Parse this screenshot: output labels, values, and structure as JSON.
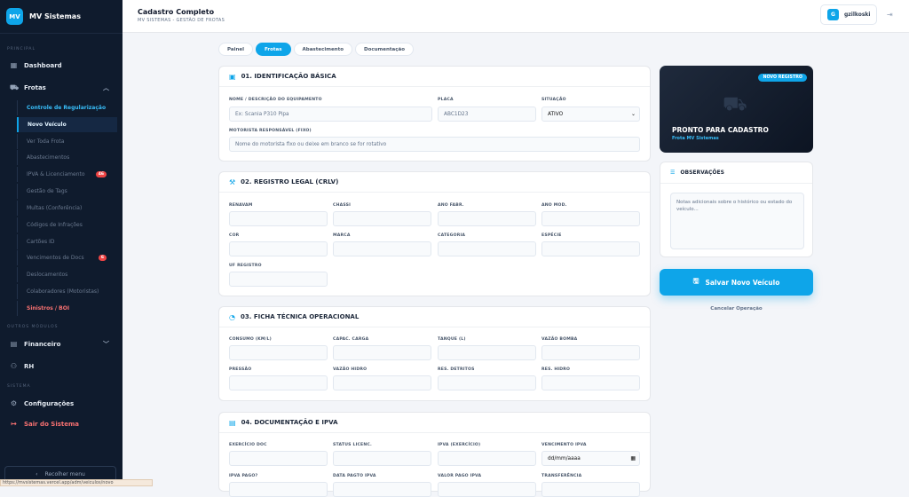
{
  "brand": {
    "logo": "MV",
    "name": "MV Sistemas"
  },
  "sidebar": {
    "sec_principal": "PRINCIPAL",
    "dashboard": "Dashboard",
    "frotas": "Frotas",
    "sub": [
      "Controle de Regularização",
      "Novo Veículo",
      "Ver Toda Frota",
      "Abastecimentos",
      "IPVA & Licenciamento",
      "Gestão de Tags",
      "Multas (Conferência)",
      "Códigos de Infrações",
      "Cartões ID",
      "Vencimentos de Docs",
      "Deslocamentos",
      "Colaboradores (Motoristas)",
      "Sinistros / BOI"
    ],
    "badge_ipva": "46",
    "badge_venc": "6",
    "sec_outros": "OUTROS MÓDULOS",
    "financeiro": "Financeiro",
    "rh": "RH",
    "sec_sistema": "SISTEMA",
    "config": "Configurações",
    "sair": "Sair do Sistema",
    "collapse": "Recolher menu"
  },
  "status_url": "https://mvsistemas.vercel.app/adm/veiculos/novo",
  "header": {
    "title": "Cadastro Completo",
    "subtitle": "MV SISTEMAS - GESTÃO DE FROTAS",
    "user_initial": "G",
    "user_name": "gzilkoski"
  },
  "tabs": [
    "Painel",
    "Frotas",
    "Abastecimento",
    "Documentação"
  ],
  "sec1": {
    "title": "01. IDENTIFICAÇÃO BÁSICA",
    "l_desc": "NOME / DESCRIÇÃO DO EQUIPAMENTO",
    "desc_ph": "Ex: Scania P310 Pipa",
    "l_placa": "PLACA",
    "placa_ph": "ABC1D23",
    "l_sit": "SITUAÇÃO",
    "sit_val": "ATIVO",
    "l_mot": "MOTORISTA RESPONSÁVEL (FIXO)",
    "mot_ph": "Nome do motorista fixo ou deixe em branco se for rotativo"
  },
  "sec2": {
    "title": "02. REGISTRO LEGAL (CRLV)",
    "labels": [
      "RENAVAM",
      "CHASSI",
      "ANO FABR.",
      "ANO MOD.",
      "COR",
      "MARCA",
      "CATEGORIA",
      "ESPÉCIE",
      "UF REGISTRO"
    ]
  },
  "sec3": {
    "title": "03. FICHA TÉCNICA OPERACIONAL",
    "labels": [
      "CONSUMO (KM/L)",
      "CAPAC. CARGA",
      "TANQUE (L)",
      "VAZÃO BOMBA",
      "PRESSÃO",
      "VAZÃO HIDRO",
      "RES. DETRITOS",
      "RES. HIDRO"
    ]
  },
  "sec4": {
    "title": "04. DOCUMENTAÇÃO E IPVA",
    "labels": [
      "EXERCÍCIO DOC",
      "STATUS LICENC.",
      "IPVA (EXERCÍCIO)",
      "VENCIMENTO IPVA",
      "IPVA PAGO?",
      "DATA PAGTO IPVA",
      "VALOR PAGO IPVA",
      "TRANSFERÊNCIA"
    ],
    "date_ph": "dd/mm/aaaa"
  },
  "hero": {
    "badge": "NOVO REGISTRO",
    "title": "PRONTO PARA CADASTRO",
    "subtitle": "Frota MV Sistemas"
  },
  "obs": {
    "title": "OBSERVAÇÕES",
    "placeholder": "Notas adicionais sobre o histórico ou estado do veículo..."
  },
  "actions": {
    "save": "Salvar Novo Veículo",
    "cancel": "Cancelar Operação"
  }
}
